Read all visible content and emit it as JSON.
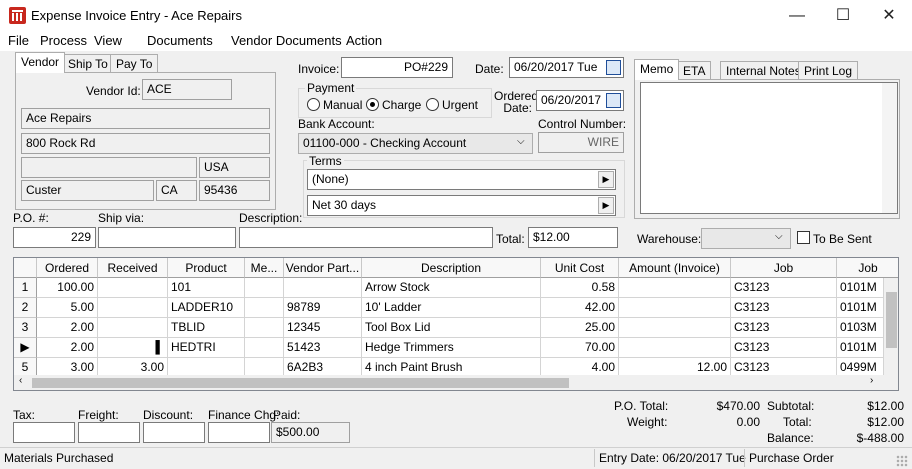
{
  "window": {
    "title": "Expense Invoice Entry - Ace Repairs",
    "minimize": "—",
    "maximize": "☐",
    "close": "✕"
  },
  "menu": [
    "File",
    "Process",
    "View",
    "Documents",
    "Vendor Documents",
    "Action"
  ],
  "vendor_tabs": [
    "Vendor",
    "Ship To",
    "Pay To"
  ],
  "vendor": {
    "id_label": "Vendor Id:",
    "id": "ACE",
    "name": "Ace Repairs",
    "address1": "800 Rock Rd",
    "address2": "",
    "country": "USA",
    "city": "Custer",
    "state": "CA",
    "zip": "95436"
  },
  "invoice": {
    "label": "Invoice:",
    "value": "PO#229"
  },
  "date": {
    "label": "Date:",
    "value": "06/20/2017 Tue"
  },
  "payment": {
    "label": "Payment",
    "options": [
      "Manual",
      "Charge",
      "Urgent"
    ],
    "selected": "Charge"
  },
  "ordered_date": {
    "label_line1": "Ordered",
    "label_line2": "Date:",
    "value": "06/20/2017"
  },
  "bank": {
    "label": "Bank Account:",
    "value": "01100-000 - Checking Account"
  },
  "control": {
    "label": "Control Number:",
    "value": "WIRE"
  },
  "terms": {
    "label": "Terms",
    "value1": "(None)",
    "value2": "Net  30 days"
  },
  "memo_tabs": [
    "Memo",
    "ETA",
    "Internal Notes",
    "Print Log"
  ],
  "po": {
    "label": "P.O. #:",
    "value": "229"
  },
  "ship_via": {
    "label": "Ship via:",
    "value": ""
  },
  "description": {
    "label": "Description:",
    "value": ""
  },
  "total": {
    "label": "Total:",
    "value": "$12.00"
  },
  "warehouse": {
    "label": "Warehouse:",
    "value": ""
  },
  "to_be_sent": {
    "label": "To Be Sent",
    "checked": false
  },
  "grid": {
    "columns": [
      "Ordered",
      "Received",
      "Product",
      "Me...",
      "Vendor Part...",
      "Description",
      "Unit Cost",
      "Amount (Invoice)",
      "Job",
      "Job"
    ],
    "rows": [
      {
        "rh": "1",
        "ordered": "100.00",
        "received": "",
        "product": "101",
        "me": "",
        "vpart": "",
        "desc": "Arrow Stock",
        "unit": "0.58",
        "amount": "",
        "job": "C3123",
        "job2": "0101M"
      },
      {
        "rh": "2",
        "ordered": "5.00",
        "received": "",
        "product": "LADDER10",
        "me": "",
        "vpart": "98789",
        "desc": "10' Ladder",
        "unit": "42.00",
        "amount": "",
        "job": "C3123",
        "job2": "0101M"
      },
      {
        "rh": "3",
        "ordered": "2.00",
        "received": "",
        "product": "TBLID",
        "me": "",
        "vpart": "12345",
        "desc": "Tool Box Lid",
        "unit": "25.00",
        "amount": "",
        "job": "C3123",
        "job2": "0103M"
      },
      {
        "rh": "▶",
        "ordered": "2.00",
        "received": "▌",
        "product": "HEDTRI",
        "me": "",
        "vpart": "51423",
        "desc": "Hedge Trimmers",
        "unit": "70.00",
        "amount": "",
        "job": "C3123",
        "job2": "0101M"
      },
      {
        "rh": "5",
        "ordered": "3.00",
        "received": "3.00",
        "product": "",
        "me": "",
        "vpart": "6A2B3",
        "desc": "4 inch Paint Brush",
        "unit": "4.00",
        "amount": "12.00",
        "job": "C3123",
        "job2": "0499M"
      }
    ]
  },
  "footer": {
    "tax": "Tax:",
    "freight": "Freight:",
    "discount": "Discount:",
    "finance": "Finance Chg:",
    "paid": "Paid:",
    "paid_value": "$500.00"
  },
  "totals": {
    "po_total_label": "P.O. Total:",
    "po_total": "$470.00",
    "weight_label": "Weight:",
    "weight": "0.00",
    "subtotal_label": "Subtotal:",
    "subtotal": "$12.00",
    "total_label": "Total:",
    "total": "$12.00",
    "balance_label": "Balance:",
    "balance": "$-488.00"
  },
  "status": {
    "left": "Materials Purchased",
    "entry_date": "Entry Date: 06/20/2017 Tue",
    "type": "Purchase Order"
  }
}
